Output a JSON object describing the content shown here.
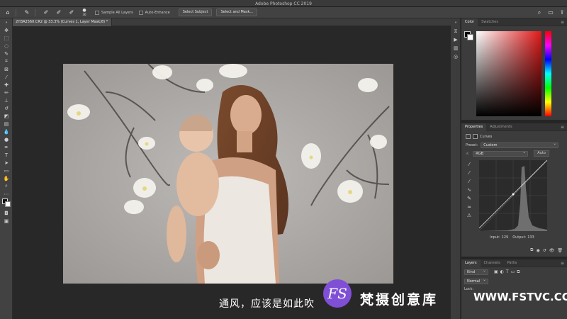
{
  "app": {
    "title": "Adobe Photoshop CC 2019"
  },
  "options_bar": {
    "brush_size": "30",
    "sample_all_layers_label": "Sample All Layers",
    "auto_enhance_label": "Auto-Enhance",
    "select_subject_label": "Select Subject",
    "select_mask_label": "Select and Mask..."
  },
  "document": {
    "tab_label": "2H3A2560.CR2 @ 33.3% (Curves 1, Layer Mask/8) *"
  },
  "color_panel": {
    "tabs": [
      "Color",
      "Swatches"
    ]
  },
  "properties_panel": {
    "tabs": [
      "Properties",
      "Adjustments"
    ],
    "adjustment_name": "Curves",
    "preset_label": "Preset:",
    "preset_value": "Custom",
    "channel_value": "RGB",
    "auto_label": "Auto",
    "input_label": "Input:",
    "input_value": "129",
    "output_label": "Output:",
    "output_value": "133"
  },
  "layers_panel": {
    "tabs": [
      "Layers",
      "Channels",
      "Paths"
    ],
    "filter_value": "Kind",
    "blend_mode": "Normal",
    "lock_label": "Lock:"
  },
  "subtitle": {
    "text": "通风，应该是如此吹"
  },
  "watermark": {
    "logo": "FS",
    "name": "梵摄创意库",
    "url": "WWW.FSTVC.CC"
  }
}
